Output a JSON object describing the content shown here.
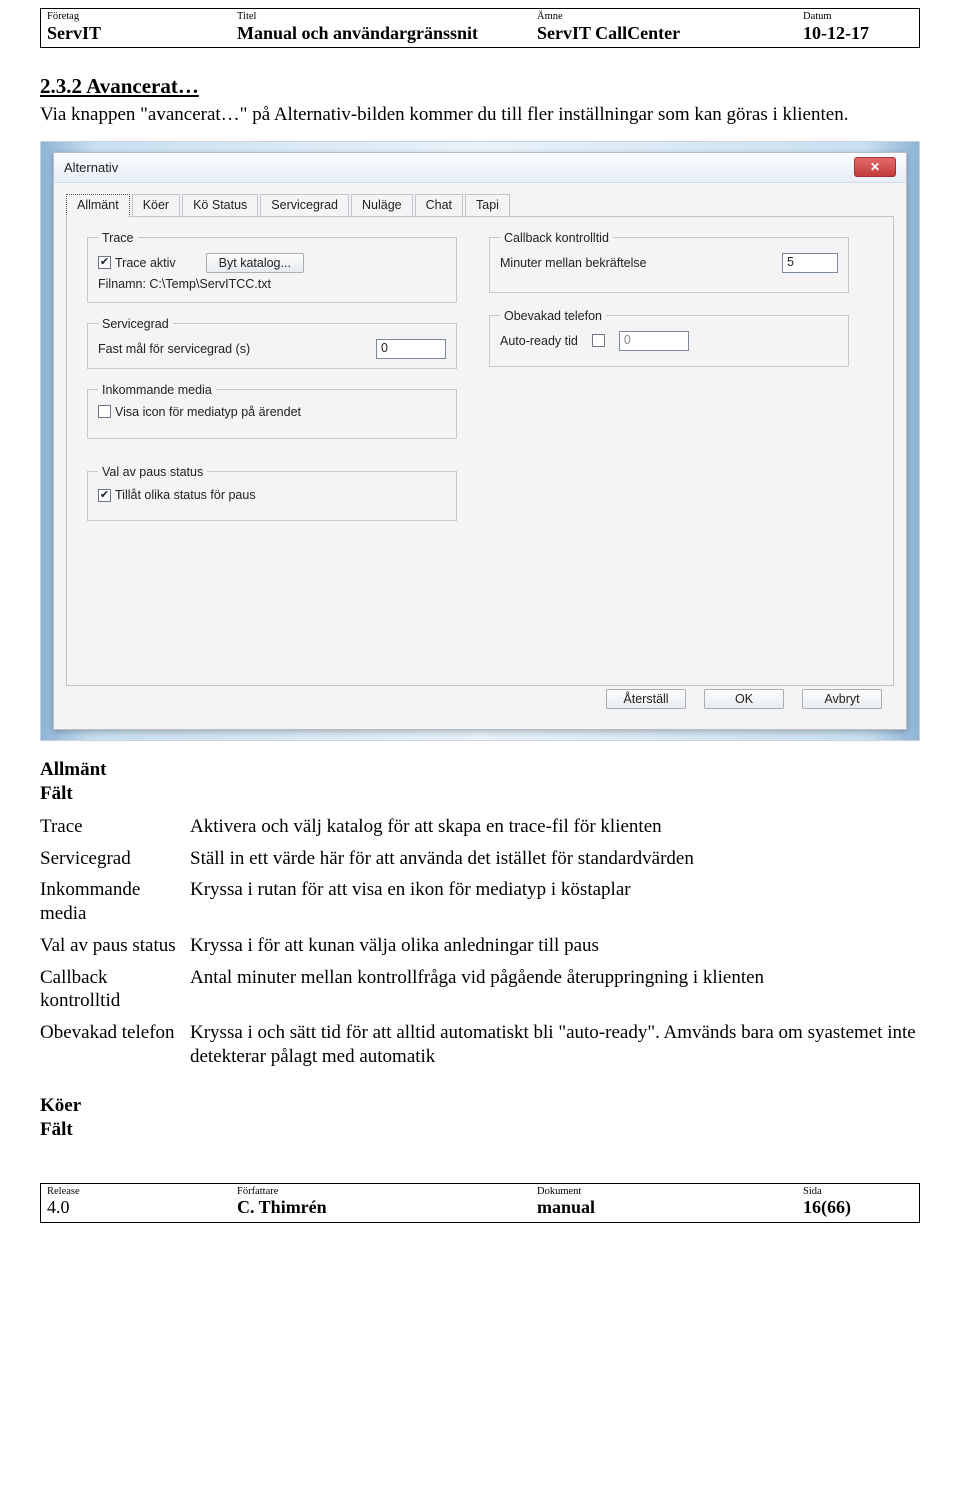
{
  "header": {
    "company_lbl": "Företag",
    "company": "ServIT",
    "title_lbl": "Titel",
    "title": "Manual och användargränssnit",
    "subject_lbl": "Ämne",
    "subject": "ServIT CallCenter",
    "date_lbl": "Datum",
    "date": "10-12-17"
  },
  "section": {
    "heading": "2.3.2  Avancerat…",
    "intro": "Via knappen \"avancerat…\" på Alternativ-bilden kommer du till fler inställningar som kan göras i klienten."
  },
  "dialog": {
    "title": "Alternativ",
    "tabs": [
      "Allmänt",
      "Köer",
      "Kö Status",
      "Servicegrad",
      "Nuläge",
      "Chat",
      "Tapi"
    ],
    "trace": {
      "legend": "Trace",
      "chk_label": "Trace aktiv",
      "chk_checked": "✔",
      "btn": "Byt katalog...",
      "file_label": "Filnamn: C:\\Temp\\ServITCC.txt"
    },
    "callback": {
      "legend": "Callback kontrolltid",
      "label": "Minuter mellan bekräftelse",
      "value": "5"
    },
    "servicegrad": {
      "legend": "Servicegrad",
      "label": "Fast mål för servicegrad (s)",
      "value": "0"
    },
    "obevakad": {
      "legend": "Obevakad telefon",
      "label": "Auto-ready tid",
      "chk_checked": "",
      "value": "0"
    },
    "inkommande": {
      "legend": "Inkommande media",
      "chk_label": "Visa icon för mediatyp på ärendet",
      "chk_checked": ""
    },
    "paus": {
      "legend": "Val av paus status",
      "chk_label": "Tillåt olika status för paus",
      "chk_checked": "✔"
    },
    "buttons": {
      "reset": "Återställ",
      "ok": "OK",
      "cancel": "Avbryt"
    }
  },
  "desc": {
    "heading": "Allmänt",
    "sub": "Fält",
    "rows": [
      {
        "k": "Trace",
        "v": "Aktivera och välj katalog för att skapa en trace-fil för klienten"
      },
      {
        "k": "Servicegrad",
        "v": "Ställ in ett värde här för att använda det istället för standardvärden"
      },
      {
        "k": "Inkommande media",
        "v": "Kryssa i rutan för att visa en ikon för mediatyp i köstaplar"
      },
      {
        "k": "Val av paus status",
        "v": "Kryssa i för att kunan välja olika anledningar till paus"
      },
      {
        "k": "Callback kontrolltid",
        "v": "Antal minuter mellan kontrollfråga vid pågående återuppringning i klienten"
      },
      {
        "k": "Obevakad telefon",
        "v": "Kryssa i och sätt tid för att alltid automatiskt bli \"auto-ready\". Amvänds bara om syastemet inte detekterar pålagt med automatik"
      }
    ],
    "koer_heading": "Köer",
    "koer_sub": "Fält"
  },
  "footer": {
    "release_lbl": "Release",
    "release": "4.0",
    "author_lbl": "Författare",
    "author": "C. Thimrén",
    "doc_lbl": "Dokument",
    "doc": "manual",
    "page_lbl": "Sida",
    "page": "16(66)"
  }
}
